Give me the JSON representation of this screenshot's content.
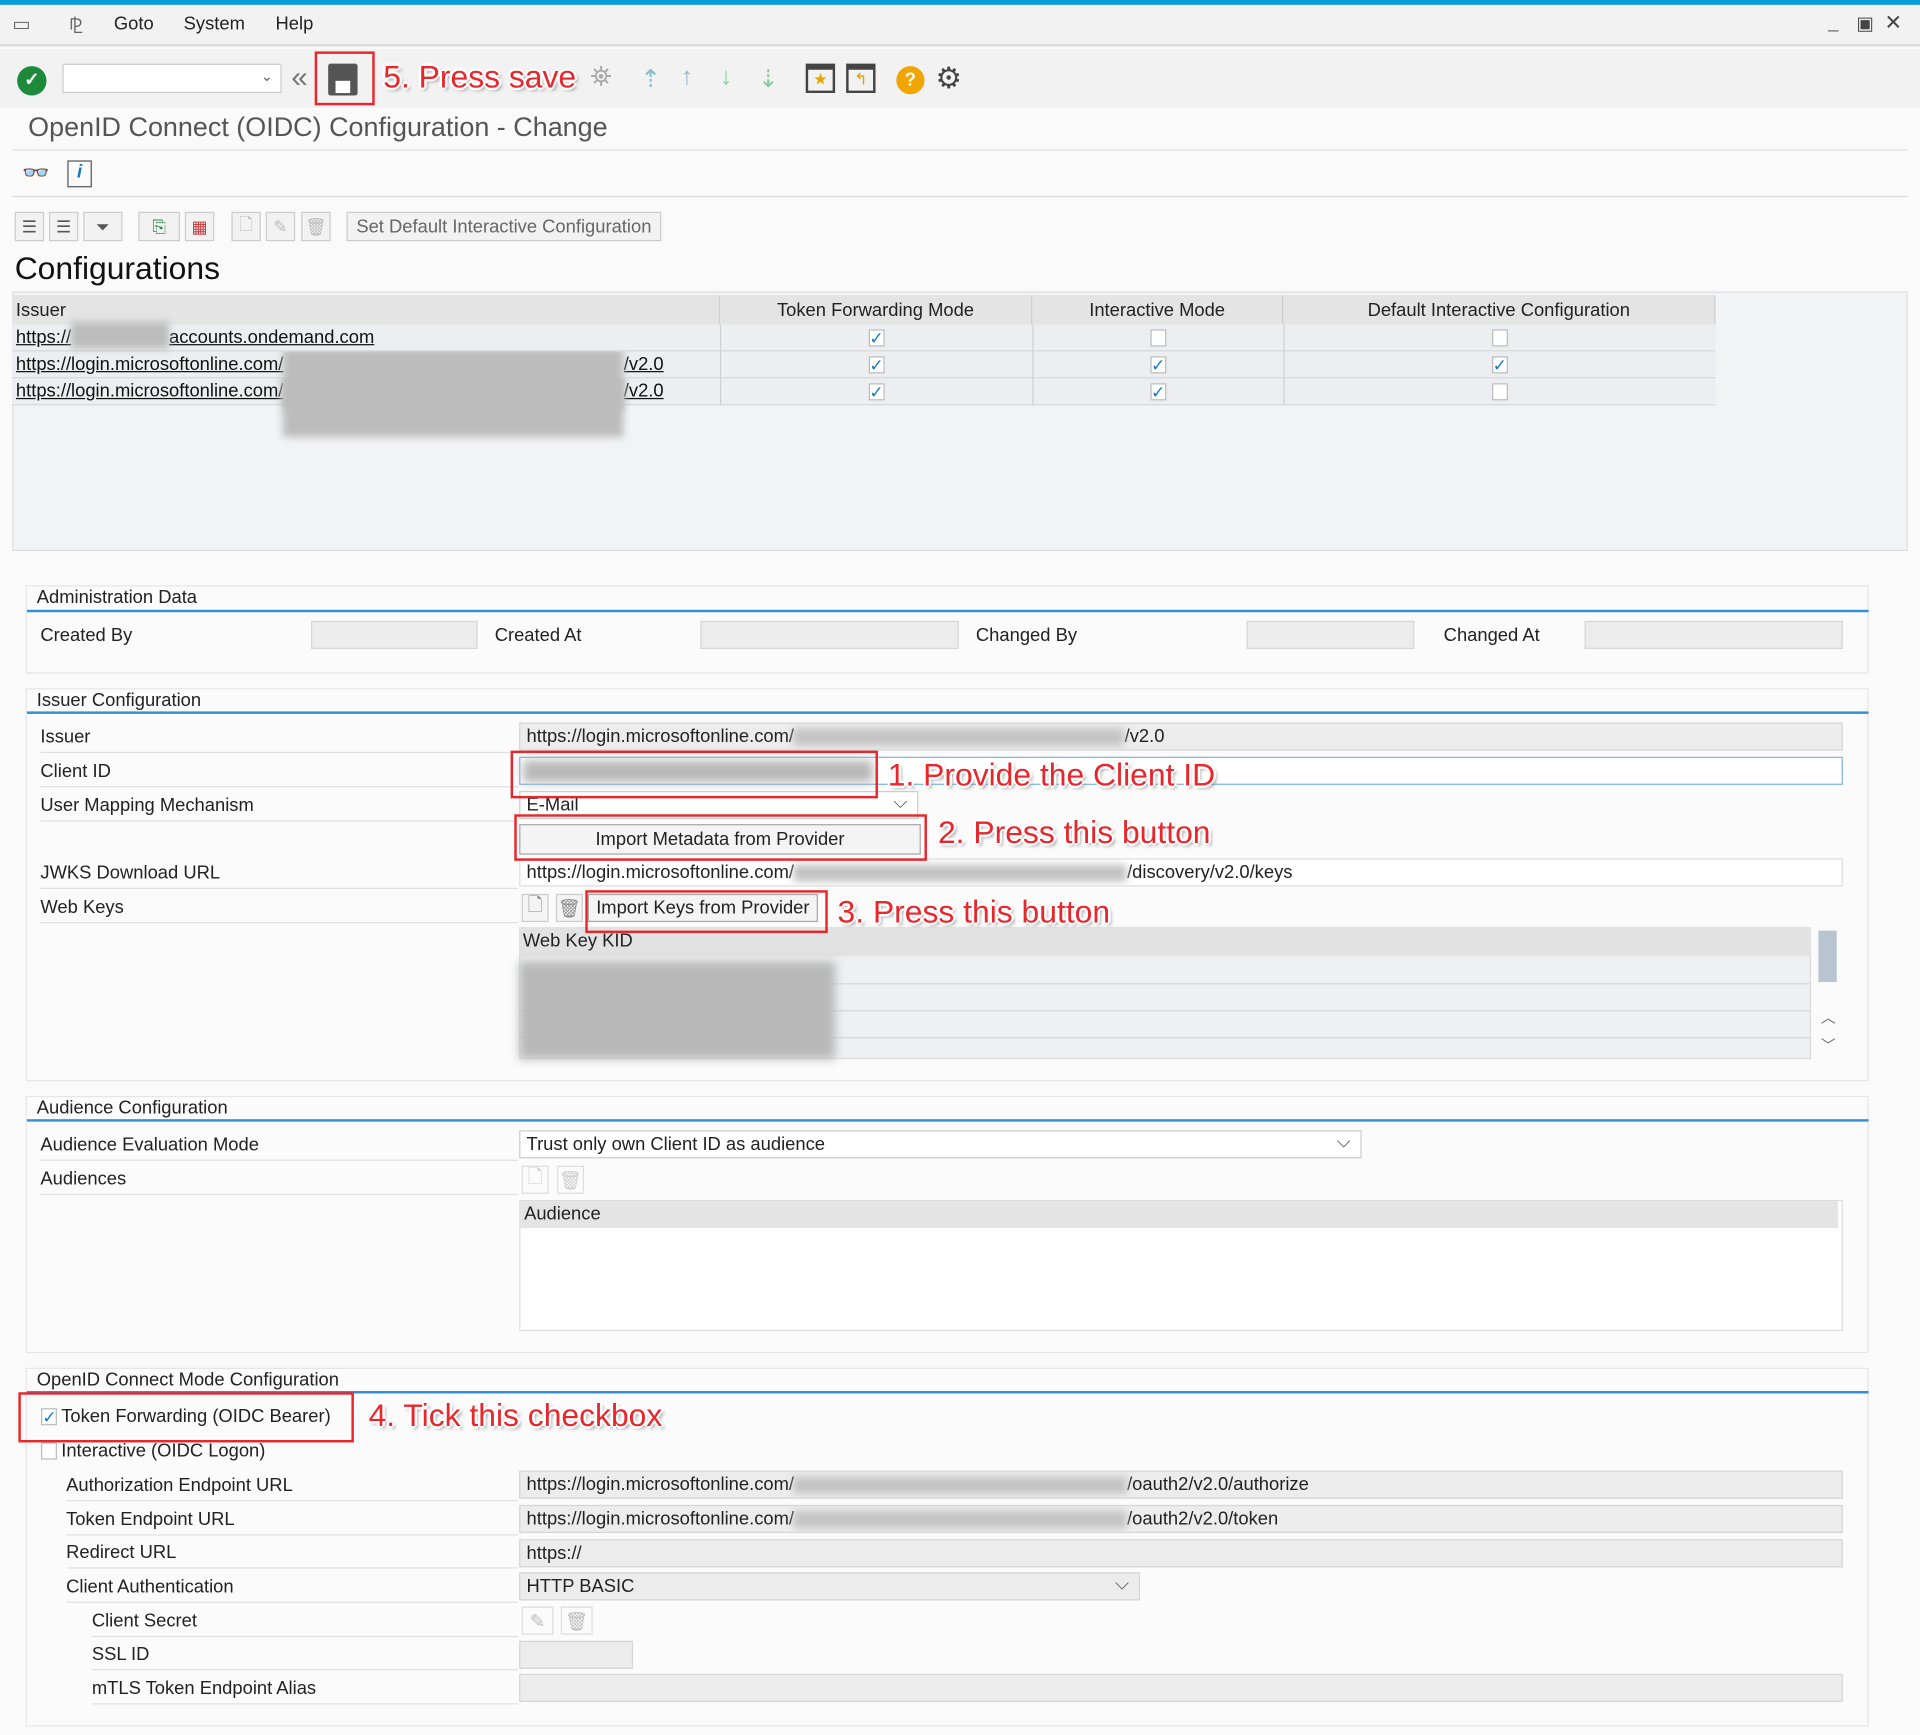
{
  "menu": {
    "items": [
      "Goto",
      "System",
      "Help"
    ]
  },
  "toolbar": {
    "command_field": "",
    "icons": [
      "enter-icon",
      "save-icon",
      "back-icon",
      "exit-icon",
      "cancel-icon",
      "find-icon",
      "first-page-icon",
      "previous-page-icon",
      "next-page-icon",
      "last-page-icon",
      "create-session-icon",
      "shortcut-icon",
      "help-icon",
      "settings-icon"
    ]
  },
  "title": "OpenID Connect (OIDC) Configuration - Change",
  "alv": {
    "set_default_button": "Set Default Interactive Configuration"
  },
  "configurations": {
    "heading": "Configurations",
    "columns": [
      "Issuer",
      "Token Forwarding Mode",
      "Interactive Mode",
      "Default Interactive Configuration"
    ],
    "rows": [
      {
        "issuer_prefix": "https://",
        "issuer_suffix": "accounts.ondemand.com",
        "token_forwarding": true,
        "interactive": false,
        "default_interactive": false
      },
      {
        "issuer_prefix": "https://login.microsoftonline.com/",
        "issuer_suffix": "/v2.0",
        "token_forwarding": true,
        "interactive": true,
        "default_interactive": true
      },
      {
        "issuer_prefix": "https://login.microsoftonline.com/",
        "issuer_suffix": "/v2.0",
        "token_forwarding": true,
        "interactive": true,
        "default_interactive": false
      }
    ]
  },
  "admin": {
    "title": "Administration Data",
    "created_by": "Created By",
    "created_at": "Created At",
    "changed_by": "Changed By",
    "changed_at": "Changed At"
  },
  "issuer_cfg": {
    "title": "Issuer Configuration",
    "issuer_label": "Issuer",
    "issuer_prefix": "https://login.microsoftonline.com/",
    "issuer_suffix": "/v2.0",
    "client_id_label": "Client ID",
    "user_mapping_label": "User Mapping Mechanism",
    "user_mapping_value": "E-Mail",
    "import_metadata_button": "Import Metadata from Provider",
    "jwks_label": "JWKS Download URL",
    "jwks_prefix": "https://login.microsoftonline.com/",
    "jwks_suffix": "/discovery/v2.0/keys",
    "web_keys_label": "Web Keys",
    "import_keys_button": "Import Keys from Provider",
    "web_key_column": "Web Key KID"
  },
  "audience_cfg": {
    "title": "Audience Configuration",
    "mode_label": "Audience Evaluation Mode",
    "mode_value": "Trust only own Client ID as audience",
    "audiences_label": "Audiences",
    "audience_column": "Audience"
  },
  "oidc_mode": {
    "title": "OpenID Connect Mode Configuration",
    "token_forwarding_label": "Token Forwarding (OIDC Bearer)",
    "token_forwarding_checked": true,
    "interactive_label": "Interactive (OIDC Logon)",
    "interactive_checked": false,
    "auth_endpoint_label": "Authorization Endpoint URL",
    "auth_prefix": "https://login.microsoftonline.com/",
    "auth_suffix": "/oauth2/v2.0/authorize",
    "token_endpoint_label": "Token Endpoint URL",
    "token_prefix": "https://login.microsoftonline.com/",
    "token_suffix": "/oauth2/v2.0/token",
    "redirect_label": "Redirect URL",
    "redirect_value": "https://",
    "client_auth_label": "Client Authentication",
    "client_auth_value": "HTTP BASIC",
    "client_secret_label": "Client Secret",
    "ssl_id_label": "SSL ID",
    "mtls_label": "mTLS Token Endpoint Alias"
  },
  "annotations": {
    "step1": "1. Provide the Client ID",
    "step2": "2. Press this button",
    "step3": "3. Press this button",
    "step4": "4. Tick this checkbox",
    "step5": "5. Press save"
  },
  "colors": {
    "accent": "#0a9bdb",
    "annotation": "#e8262b",
    "section_line": "#2f8fd5"
  }
}
